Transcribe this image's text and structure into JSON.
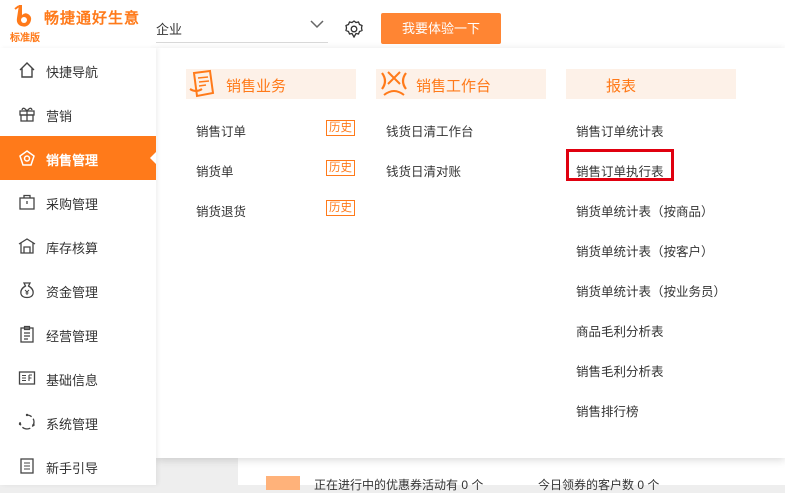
{
  "brand": {
    "title": "畅捷通好生意",
    "edition": "标准版"
  },
  "header": {
    "company": "企业",
    "try_button": "我要体验一下"
  },
  "sidebar": {
    "items": [
      {
        "label": "快捷导航",
        "icon": "home-icon"
      },
      {
        "label": "营销",
        "icon": "gift-icon"
      },
      {
        "label": "销售管理",
        "icon": "sales-icon",
        "active": true
      },
      {
        "label": "采购管理",
        "icon": "briefcase-icon"
      },
      {
        "label": "库存核算",
        "icon": "warehouse-icon"
      },
      {
        "label": "资金管理",
        "icon": "money-bag-icon"
      },
      {
        "label": "经营管理",
        "icon": "clipboard-icon"
      },
      {
        "label": "基础信息",
        "icon": "info-card-icon"
      },
      {
        "label": "系统管理",
        "icon": "system-icon"
      },
      {
        "label": "新手引导",
        "icon": "guide-icon"
      }
    ]
  },
  "menu": {
    "sales_business": {
      "title": "销售业务",
      "items": [
        {
          "label": "销售订单",
          "badge": "历史"
        },
        {
          "label": "销货单",
          "badge": "历史"
        },
        {
          "label": "销货退货",
          "badge": "历史"
        }
      ]
    },
    "sales_workbench": {
      "title": "销售工作台",
      "items": [
        {
          "label": "钱货日清工作台"
        },
        {
          "label": "钱货日清对账"
        }
      ]
    },
    "reports": {
      "title": "报表",
      "items": [
        {
          "label": "销售订单统计表"
        },
        {
          "label": "销售订单执行表"
        },
        {
          "label": "销货单统计表（按商品）"
        },
        {
          "label": "销货单统计表（按客户）"
        },
        {
          "label": "销货单统计表（按业务员）"
        },
        {
          "label": "商品毛利分析表"
        },
        {
          "label": "销售毛利分析表"
        },
        {
          "label": "销售排行榜"
        }
      ]
    }
  },
  "bottom": {
    "text1": "正在进行中的优惠券活动有 0 个",
    "text2": "今日领券的客户数 0 个"
  },
  "colors": {
    "accent": "#ff7a1a",
    "highlight": "#e0000f"
  }
}
